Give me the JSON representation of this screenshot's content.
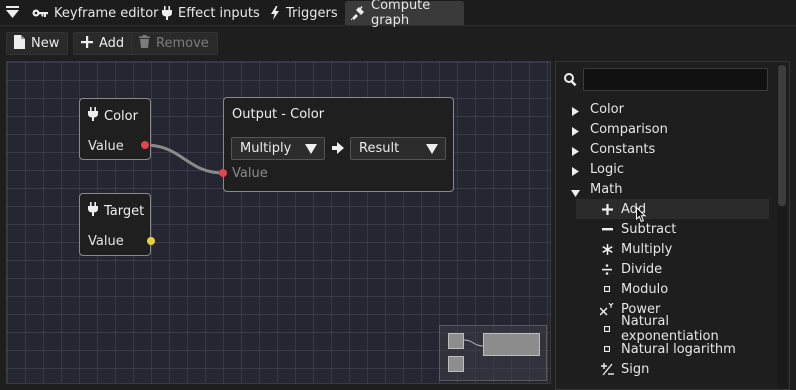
{
  "tabs": [
    {
      "label": "Keyframe editor",
      "icon": "key-icon"
    },
    {
      "label": "Effect inputs",
      "icon": "plug-icon"
    },
    {
      "label": "Triggers",
      "icon": "bolt-icon"
    },
    {
      "label": "Compute graph",
      "icon": "plug-connect-icon",
      "active": true
    }
  ],
  "toolbar": {
    "new_label": "New",
    "add_label": "Add",
    "remove_label": "Remove"
  },
  "nodes": {
    "color": {
      "title": "Color",
      "port": "Value"
    },
    "target": {
      "title": "Target",
      "port": "Value"
    },
    "output": {
      "title": "Output - Color",
      "op": "Multiply",
      "result": "Result",
      "port": "Value"
    }
  },
  "colors": {
    "port_red": "#e0454f",
    "port_yellow": "#e8d13a",
    "wire": "#8a8a8a",
    "canvas_bg": "#262633"
  },
  "search": {
    "value": "",
    "placeholder": ""
  },
  "tree": {
    "categories": [
      "Color",
      "Comparison",
      "Constants",
      "Logic",
      "Math"
    ],
    "math_items": [
      {
        "label": "Add",
        "icon": "plus-icon"
      },
      {
        "label": "Subtract",
        "icon": "minus-icon"
      },
      {
        "label": "Multiply",
        "icon": "asterisk-icon"
      },
      {
        "label": "Divide",
        "icon": "divide-icon"
      },
      {
        "label": "Modulo",
        "icon": "small-square-icon"
      },
      {
        "label": "Power",
        "icon": "power-icon"
      },
      {
        "label": "Natural exponentiation",
        "icon": "small-square-icon"
      },
      {
        "label": "Natural logarithm",
        "icon": "small-square-icon"
      },
      {
        "label": "Sign",
        "icon": "plus-minus-icon"
      }
    ]
  }
}
